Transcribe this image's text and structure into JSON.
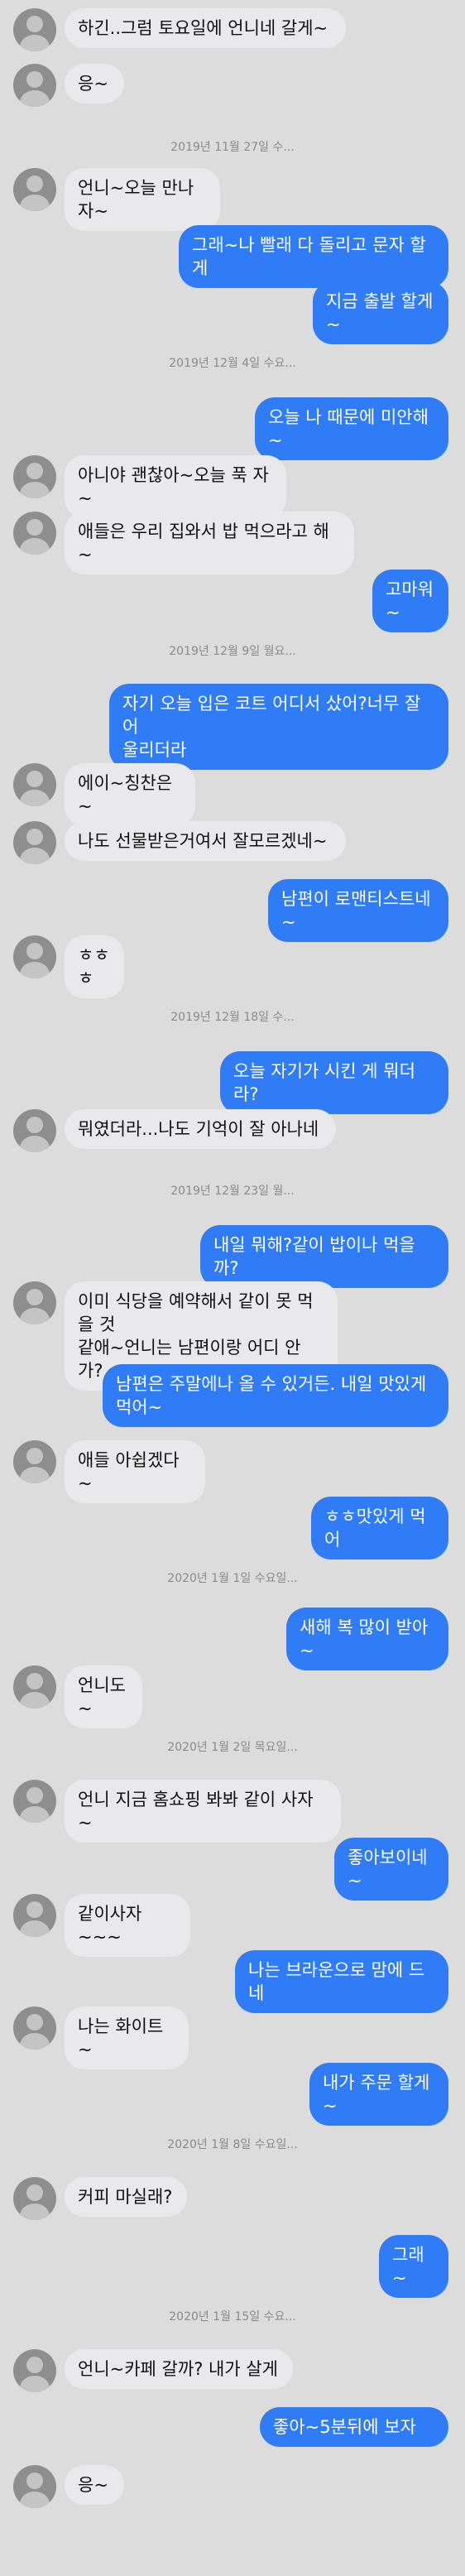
{
  "messages": [
    {
      "type": "in",
      "text": "하긴..그럼 토요일에 언니네 갈게~"
    },
    {
      "type": "in",
      "text": "응~"
    },
    {
      "type": "date",
      "text": "2019년 11월 27일 수..."
    },
    {
      "type": "in",
      "text": "언니~오늘 만나자~"
    },
    {
      "type": "out",
      "text": "그래~나 빨래 다 돌리고 문자 할게"
    },
    {
      "type": "out",
      "text": "지금 출발 할게~"
    },
    {
      "type": "date",
      "text": "2019년 12월 4일 수요..."
    },
    {
      "type": "out",
      "text": "오늘 나 때문에 미안해~"
    },
    {
      "type": "in",
      "text": "아니야 괜찮아~오늘 푹 자~"
    },
    {
      "type": "in",
      "text": "애들은 우리 집와서 밥 먹으라고 해~"
    },
    {
      "type": "out",
      "text": "고마워~"
    },
    {
      "type": "date",
      "text": "2019년 12월 9일 월요..."
    },
    {
      "type": "out",
      "text": "자기 오늘 입은 코트 어디서 샀어?너무 잘어\n울리더라"
    },
    {
      "type": "in",
      "text": "에이~칭찬은~"
    },
    {
      "type": "in",
      "text": "나도 선물받은거여서 잘모르겠네~"
    },
    {
      "type": "out",
      "text": "남편이 로맨티스트네~"
    },
    {
      "type": "in",
      "text": "ㅎㅎㅎ"
    },
    {
      "type": "date",
      "text": "2019년 12월 18일 수..."
    },
    {
      "type": "out",
      "text": "오늘 자기가 시킨 게 뭐더라?"
    },
    {
      "type": "in",
      "text": "뭐였더라...나도 기억이 잘 아나네"
    },
    {
      "type": "date",
      "text": "2019년 12월 23일 월..."
    },
    {
      "type": "out",
      "text": "내일 뭐해?같이 밥이나 먹을까?"
    },
    {
      "type": "in",
      "text": "이미 식당을 예약해서 같이 못 먹을 것\n같애~언니는 남편이랑 어디 안가?"
    },
    {
      "type": "out",
      "text": "남편은 주말에나 올 수 있거든. 내일 맛있게\n먹어~"
    },
    {
      "type": "in",
      "text": "애들 아쉽겠다~"
    },
    {
      "type": "out",
      "text": "ㅎㅎ맛있게 먹어"
    },
    {
      "type": "date",
      "text": "2020년 1월 1일 수요일..."
    },
    {
      "type": "out",
      "text": "새해 복 많이 받아~"
    },
    {
      "type": "in",
      "text": "언니도~"
    },
    {
      "type": "date",
      "text": "2020년 1월 2일 목요일..."
    },
    {
      "type": "in",
      "text": "언니 지금 홈쇼핑 봐봐 같이 사자~"
    },
    {
      "type": "out",
      "text": "좋아보이네~"
    },
    {
      "type": "in",
      "text": "같이사자~~~"
    },
    {
      "type": "out",
      "text": "나는 브라운으로 맘에 드네"
    },
    {
      "type": "in",
      "text": "나는 화이트~"
    },
    {
      "type": "out",
      "text": "내가 주문 할게~"
    },
    {
      "type": "date",
      "text": "2020년 1월 8일 수요일..."
    },
    {
      "type": "in",
      "text": "커피 마실래?"
    },
    {
      "type": "out",
      "text": "그래~"
    },
    {
      "type": "date",
      "text": "2020년 1월 15일 수요..."
    },
    {
      "type": "in",
      "text": "언니~카페 갈까? 내가 살게"
    },
    {
      "type": "out",
      "text": "좋아~5분뒤에 보자"
    },
    {
      "type": "in",
      "text": "응~"
    }
  ]
}
